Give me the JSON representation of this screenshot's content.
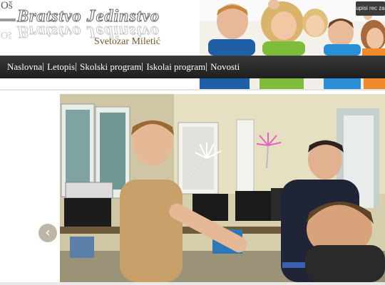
{
  "header": {
    "logo_text": "Oš",
    "title": "Bratstvo Jedinstvo",
    "subtitle": "Svetozar Miletić",
    "lang_button": "upisi rec za"
  },
  "nav": {
    "items": [
      {
        "label": "Naslovna"
      },
      {
        "label": "Letopis"
      },
      {
        "label": "Skolski program"
      },
      {
        "label": "Iskolai program"
      },
      {
        "label": "Novosti"
      }
    ]
  },
  "slideshow": {
    "prev_icon": "‹"
  },
  "colors": {
    "nav_bg": "#2a2a2a",
    "subtitle": "#7a5a2a",
    "prev_button": "#bfb7a6"
  }
}
